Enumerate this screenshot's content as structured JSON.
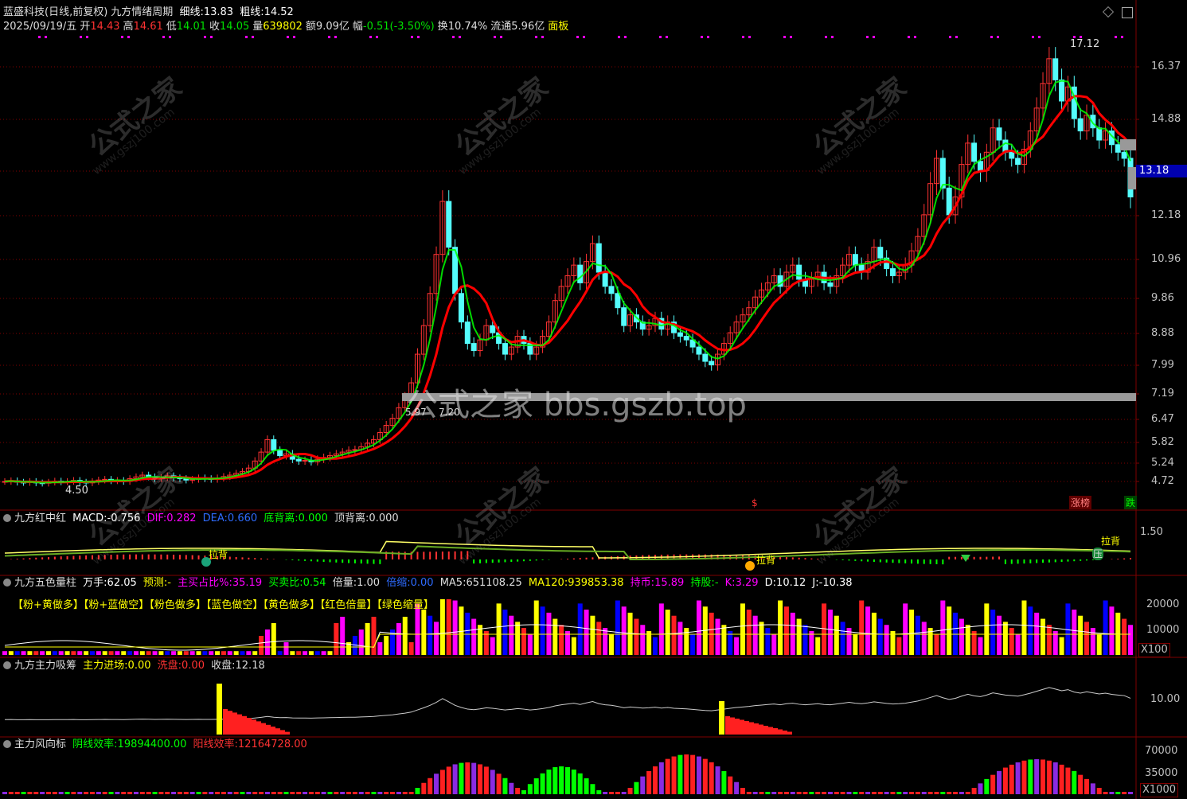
{
  "title_bar": {
    "stock": "蓝盛科技(日线,前复权)",
    "indicator": "九方情绪周期",
    "thin_label": "细线:",
    "thin_value": "13.83",
    "thick_label": "粗线:",
    "thick_value": "14.52"
  },
  "quote": {
    "date": "2025/09/19/五",
    "open_label": "开",
    "open": "14.43",
    "high_label": "高",
    "high": "14.61",
    "low_label": "低",
    "low": "14.01",
    "close_label": "收",
    "close": "14.05",
    "vol_label": "量",
    "vol": "639802",
    "amt_label": "额",
    "amt": "9.09亿",
    "chg_label": "幅",
    "chg": "-0.51(-3.50%)",
    "turn_label": "换",
    "turn": "10.74%",
    "float_label": "流通",
    "float": "5.96亿",
    "panel_button": "面板"
  },
  "price_axis": [
    "16.37",
    "14.88",
    "13.18",
    "12.18",
    "10.96",
    "9.86",
    "8.88",
    "7.99",
    "7.19",
    "6.47",
    "5.82",
    "5.24",
    "4.72"
  ],
  "current_price_tag": "13.18",
  "annotations": {
    "max_label": "17.12",
    "min_label": "4.50",
    "mid_label_a": "5.97",
    "mid_label_b": "7.20",
    "dollar_mark": "$",
    "zhangbang": "涨榜",
    "die": "跌"
  },
  "watermarks": {
    "site_cn": "公式之家",
    "site_url": "www.gszj100.com",
    "big": "公式之家 bbs.gszb.top"
  },
  "macd_panel": {
    "name": "九方红中红",
    "macd_label": "MACD:",
    "macd": "-0.756",
    "dif_label": "DIF:",
    "dif": "0.282",
    "dea_label": "DEA:",
    "dea": "0.660",
    "bottom_div_label": "底背离:",
    "bottom_div": "0.000",
    "top_div_label": "顶背离:",
    "top_div": "0.000",
    "axis": "1.50",
    "tag_labei": "拉背",
    "tag_ya": "压"
  },
  "volume_panel": {
    "name": "九方五色量柱",
    "wanshou_label": "万手:",
    "wanshou": "62.05",
    "yuce_label": "预测:",
    "yuce": "-",
    "zhumai_label": "主买占比%:",
    "zhumai": "35.19",
    "maimai_label": "买卖比:",
    "maimai": "0.54",
    "beiliang_label": "倍量:",
    "beiliang": "1.00",
    "beisuo_label": "倍缩:",
    "beisuo": "0.00",
    "ma5_label": "MA5:",
    "ma5": "651108.25",
    "ma120_label": "MA120:",
    "ma120": "939853.38",
    "chibi_label": "持币:",
    "chibi": "15.89",
    "chigu_label": "持股:",
    "chigu": "-",
    "k_label": "K:",
    "k": "3.29",
    "d_label": "D:",
    "d": "10.12",
    "j_label": "J:",
    "j": "-10.38",
    "legend": [
      "【粉+黄做多】",
      "【粉+蓝做空】",
      "【粉色做多】",
      "【蓝色做空】",
      "【黄色做多】",
      "【红色倍量】",
      "【绿色缩量】"
    ],
    "axis": [
      "20000",
      "10000"
    ],
    "unit": "X100"
  },
  "absorb_panel": {
    "name": "九方主力吸筹",
    "zljc_label": "主力进场:",
    "zljc": "0.00",
    "xipan_label": "洗盘:",
    "xipan": "0.00",
    "shoupan_label": "收盘:",
    "shoupan": "12.18",
    "axis": "10.00"
  },
  "wind_panel": {
    "name": "主力风向标",
    "yin_label": "阴线效率:",
    "yin": "19894400.00",
    "yang_label": "阳线效率:",
    "yang": "12164728.00",
    "axis": [
      "70000",
      "35000"
    ],
    "unit": "X1000"
  },
  "colors": {
    "bg": "#000000",
    "up": "#ff3232",
    "down": "#54fcfc",
    "thick_line": "#ff0000",
    "thin_line": "#00ff00",
    "grid": "#800000",
    "axis_text": "#c0c0c0",
    "magenta": "#ff00ff",
    "yellow": "#ffff00",
    "blue": "#0000ff",
    "green": "#00ff00"
  },
  "chart_data": {
    "type": "candlestick",
    "series_close": [
      4.72,
      4.74,
      4.7,
      4.69,
      4.72,
      4.68,
      4.67,
      4.7,
      4.73,
      4.71,
      4.72,
      4.75,
      4.7,
      4.68,
      4.72,
      4.76,
      4.78,
      4.74,
      4.75,
      4.72,
      4.8,
      4.85,
      4.9,
      4.85,
      4.8,
      4.83,
      4.88,
      4.82,
      4.8,
      4.76,
      4.78,
      4.82,
      4.8,
      4.78,
      4.82,
      4.86,
      4.9,
      4.95,
      5.0,
      5.1,
      5.3,
      5.55,
      5.9,
      5.6,
      5.45,
      5.5,
      5.35,
      5.3,
      5.32,
      5.28,
      5.35,
      5.4,
      5.45,
      5.5,
      5.55,
      5.6,
      5.62,
      5.7,
      5.8,
      5.9,
      6.1,
      6.3,
      6.5,
      6.8,
      7.1,
      7.5,
      8.3,
      9.1,
      10.0,
      11.1,
      12.5,
      11.3,
      10.0,
      9.2,
      8.6,
      8.4,
      8.7,
      9.1,
      8.9,
      8.6,
      8.3,
      8.5,
      8.8,
      8.6,
      8.3,
      8.5,
      8.8,
      9.2,
      9.8,
      10.2,
      10.5,
      10.8,
      10.3,
      10.9,
      11.4,
      10.6,
      10.2,
      10.0,
      9.6,
      9.1,
      9.4,
      9.2,
      9.0,
      9.1,
      9.3,
      9.0,
      9.2,
      8.9,
      8.8,
      8.7,
      8.5,
      8.3,
      8.1,
      8.0,
      8.3,
      8.6,
      8.9,
      9.2,
      9.4,
      9.6,
      9.9,
      10.1,
      10.3,
      10.5,
      10.2,
      10.6,
      10.8,
      10.4,
      10.2,
      10.4,
      10.6,
      10.3,
      10.2,
      10.5,
      10.8,
      11.1,
      10.8,
      10.6,
      10.9,
      11.3,
      11.0,
      10.7,
      10.5,
      10.6,
      10.8,
      11.2,
      11.6,
      12.2,
      12.9,
      13.6,
      12.8,
      12.2,
      12.6,
      13.4,
      14.1,
      13.5,
      13.2,
      13.8,
      14.6,
      14.2,
      13.8,
      13.6,
      13.4,
      13.9,
      14.5,
      15.2,
      15.9,
      16.6,
      16.0,
      15.4,
      15.8,
      14.9,
      14.5,
      15.0,
      14.6,
      14.2,
      14.5,
      14.05,
      13.8,
      13.6,
      12.6
    ],
    "price_range": [
      4.5,
      17.12
    ],
    "last_close": 14.05
  }
}
